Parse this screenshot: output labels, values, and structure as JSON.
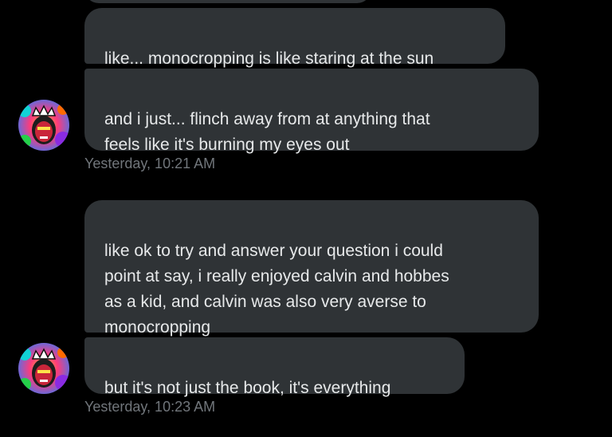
{
  "messages": [
    {
      "text": "like... monocropping is like staring at the sun"
    },
    {
      "text": "and i just... flinch away from at anything that\nfeels like it's burning my eyes out"
    },
    {
      "text": "like ok to try and answer your question i could\npoint at say, i really enjoyed calvin and hobbes\nas a kid, and calvin was also very averse to\nmonocropping"
    },
    {
      "text": "but it's not just the book, it's everything"
    }
  ],
  "timestamps": [
    "Yesterday, 10:21 AM",
    "Yesterday, 10:23 AM"
  ],
  "colors": {
    "background": "#000000",
    "bubble": "#2f3336",
    "message_text": "#e7e9ea",
    "timestamp_text": "#71767b"
  },
  "icons": [
    "colorful-portrait-avatar-icon"
  ]
}
